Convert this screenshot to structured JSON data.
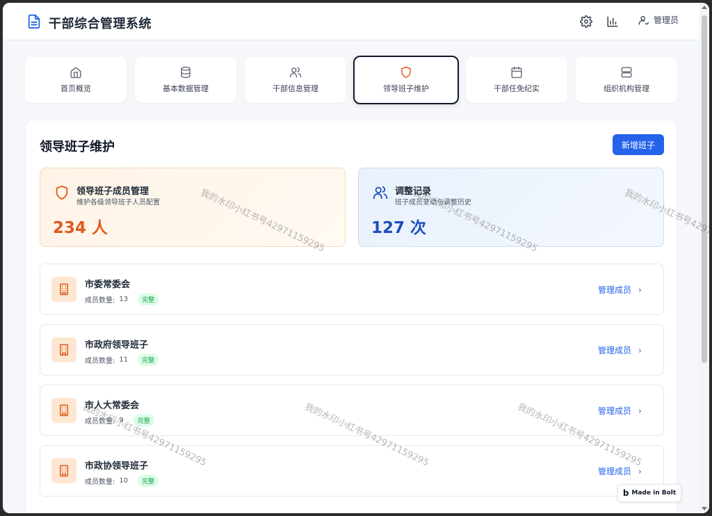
{
  "header": {
    "title": "干部综合管理系统",
    "admin_label": "管理员"
  },
  "nav": {
    "items": [
      {
        "label": "首页概览",
        "icon": "home-icon"
      },
      {
        "label": "基本数据管理",
        "icon": "database-icon"
      },
      {
        "label": "干部信息管理",
        "icon": "users-icon"
      },
      {
        "label": "领导班子维护",
        "icon": "shield-icon"
      },
      {
        "label": "干部任免纪实",
        "icon": "calendar-icon"
      },
      {
        "label": "组织机构管理",
        "icon": "server-icon"
      }
    ],
    "active_index": 3
  },
  "main": {
    "title": "领导班子维护",
    "add_button": "新增班子",
    "stats": [
      {
        "title": "领导班子成员管理",
        "desc": "维护各级领导班子人员配置",
        "value": "234 人",
        "icon": "shield-icon"
      },
      {
        "title": "调整记录",
        "desc": "班子成员变动与调整历史",
        "value": "127 次",
        "icon": "users-icon"
      }
    ],
    "org_list": [
      {
        "name": "市委常委会",
        "count_label": "成员数量:",
        "count": "13",
        "status": "完整",
        "action": "管理成员"
      },
      {
        "name": "市政府领导班子",
        "count_label": "成员数量:",
        "count": "11",
        "status": "完整",
        "action": "管理成员"
      },
      {
        "name": "市人大常委会",
        "count_label": "成员数量:",
        "count": "9",
        "status": "完整",
        "action": "管理成员"
      },
      {
        "name": "市政协领导班子",
        "count_label": "成员数量:",
        "count": "10",
        "status": "完整",
        "action": "管理成员"
      }
    ]
  },
  "badge": {
    "label": "Made in Bolt"
  },
  "watermark": "我的水印小红书号42971159295",
  "colors": {
    "accent": "#2563eb",
    "orange": "#e05a1c",
    "success": "#16a34a"
  }
}
